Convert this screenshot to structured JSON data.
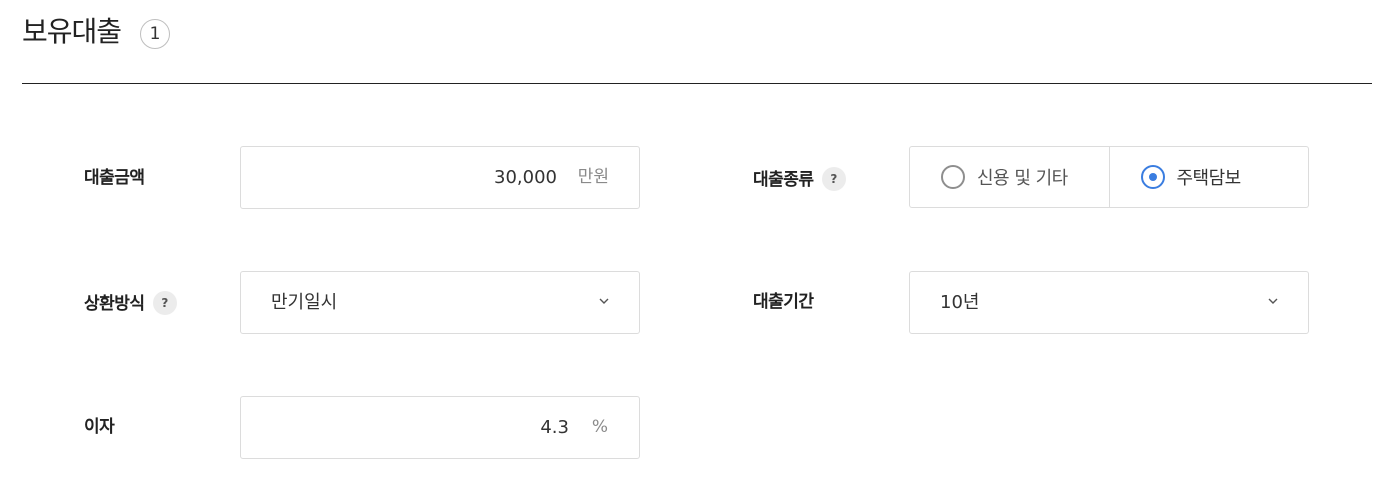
{
  "header": {
    "title": "보유대출",
    "count": "1"
  },
  "form": {
    "loan_amount": {
      "label": "대출금액",
      "value": "30,000",
      "unit": "만원"
    },
    "loan_type": {
      "label": "대출종류",
      "help_icon": "?",
      "options": [
        "신용 및 기타",
        "주택담보"
      ],
      "selected": "주택담보"
    },
    "repayment_method": {
      "label": "상환방식",
      "help_icon": "?",
      "value": "만기일시"
    },
    "loan_period": {
      "label": "대출기간",
      "value": "10년"
    },
    "interest": {
      "label": "이자",
      "value": "4.3",
      "unit": "%"
    }
  },
  "icons": {
    "help": "question-mark",
    "dropdown": "chevron-down"
  },
  "colors": {
    "accent": "#3a7de0",
    "border": "#dcdcdc",
    "text": "#222222"
  }
}
